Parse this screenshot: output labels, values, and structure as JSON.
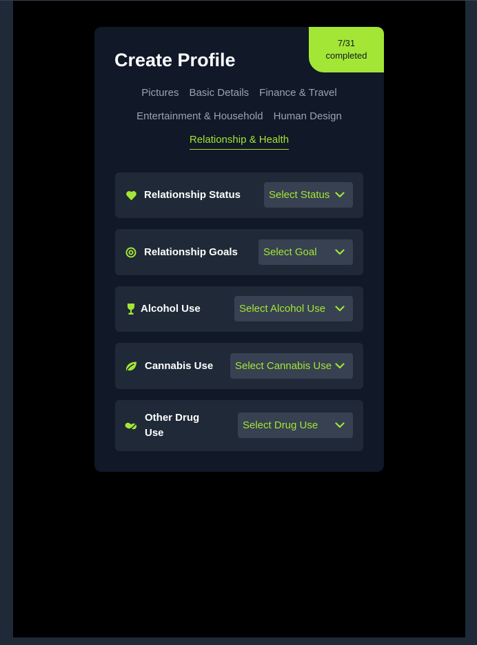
{
  "header": {
    "title": "Create Profile",
    "progress": {
      "count": "7/31",
      "label": "completed"
    }
  },
  "tabs": [
    {
      "label": "Pictures",
      "active": false
    },
    {
      "label": "Basic Details",
      "active": false
    },
    {
      "label": "Finance & Travel",
      "active": false
    },
    {
      "label": "Entertainment & Household",
      "active": false
    },
    {
      "label": "Human Design",
      "active": false
    },
    {
      "label": "Relationship & Health",
      "active": true
    }
  ],
  "fields": [
    {
      "label": "Relationship Status",
      "placeholder": "Select Status",
      "icon": "heart-icon"
    },
    {
      "label": "Relationship Goals",
      "placeholder": "Select Goal",
      "icon": "target-icon"
    },
    {
      "label": "Alcohol Use",
      "placeholder": "Select Alcohol Use",
      "icon": "wine-glass-icon"
    },
    {
      "label": "Cannabis Use",
      "placeholder": "Select Cannabis Use",
      "icon": "leaf-icon"
    },
    {
      "label": "Other Drug Use",
      "placeholder": "Select Drug Use",
      "icon": "pills-icon"
    }
  ],
  "colors": {
    "accent": "#a3e635",
    "card": "#111827",
    "row": "#1f2937",
    "select": "#374151",
    "page": "#000000"
  }
}
